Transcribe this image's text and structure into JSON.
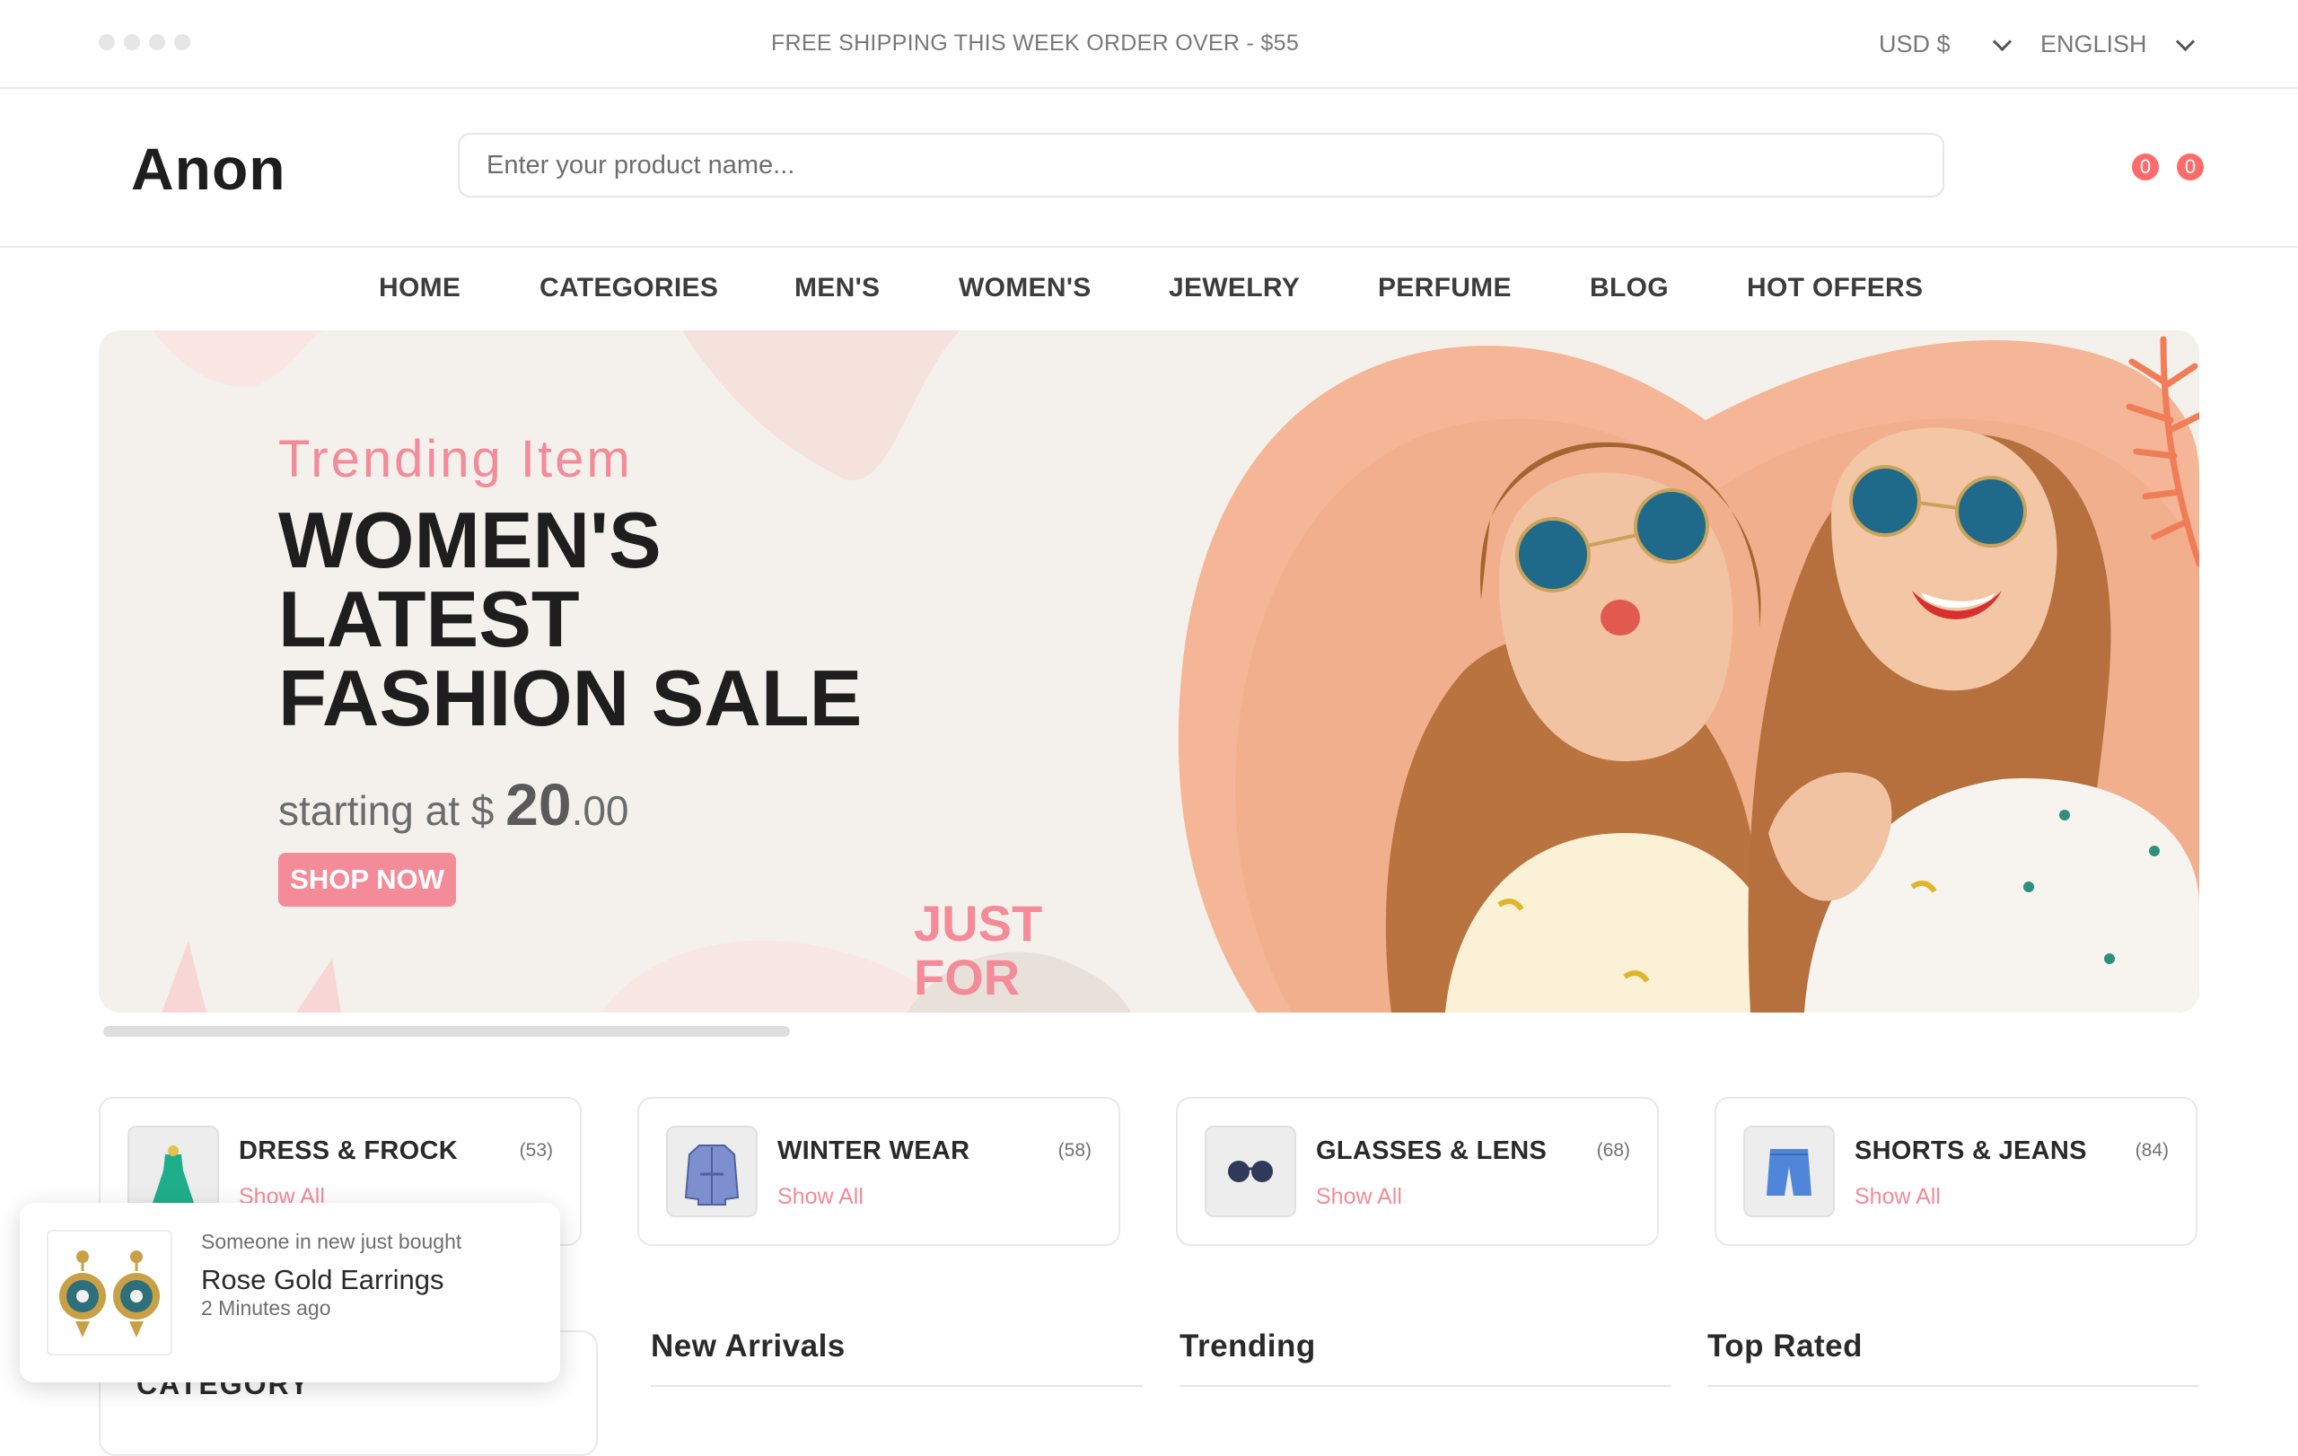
{
  "topbar": {
    "shipping_notice": "FREE SHIPPING THIS WEEK ORDER OVER - $55",
    "currency": "USD $",
    "language": "ENGLISH"
  },
  "header": {
    "logo": "Anon",
    "search_placeholder": "Enter your product name...",
    "wishlist_count": "0",
    "cart_count": "0"
  },
  "nav": [
    "HOME",
    "CATEGORIES",
    "MEN'S",
    "WOMEN'S",
    "JEWELRY",
    "PERFUME",
    "BLOG",
    "HOT OFFERS"
  ],
  "hero": {
    "kicker": "Trending Item",
    "title_line1": "WOMEN'S",
    "title_line2": "LATEST",
    "title_line3": "FASHION SALE",
    "price_prefix": "starting at $ ",
    "price_whole": "20",
    "price_cents": ".00",
    "button": "SHOP NOW",
    "decor_text_line1": "JUST",
    "decor_text_line2": "FOR"
  },
  "categories": [
    {
      "name": "DRESS & FROCK",
      "count": "(53)",
      "link": "Show All",
      "icon": "dress-icon"
    },
    {
      "name": "WINTER WEAR",
      "count": "(58)",
      "link": "Show All",
      "icon": "coat-icon"
    },
    {
      "name": "GLASSES & LENS",
      "count": "(68)",
      "link": "Show All",
      "icon": "glasses-icon"
    },
    {
      "name": "SHORTS & JEANS",
      "count": "(84)",
      "link": "Show All",
      "icon": "shorts-icon"
    }
  ],
  "sidebar": {
    "title": "CATEGORY"
  },
  "columns": [
    "New Arrivals",
    "Trending",
    "Top Rated"
  ],
  "toast": {
    "subtitle": "Someone in new just bought",
    "title": "Rose Gold Earrings",
    "time": "2 Minutes ago",
    "icon": "earrings-icon"
  },
  "colors": {
    "accent": "#f48b98",
    "badge": "#ff6b6b",
    "hero_bg": "#f4f1ec"
  }
}
